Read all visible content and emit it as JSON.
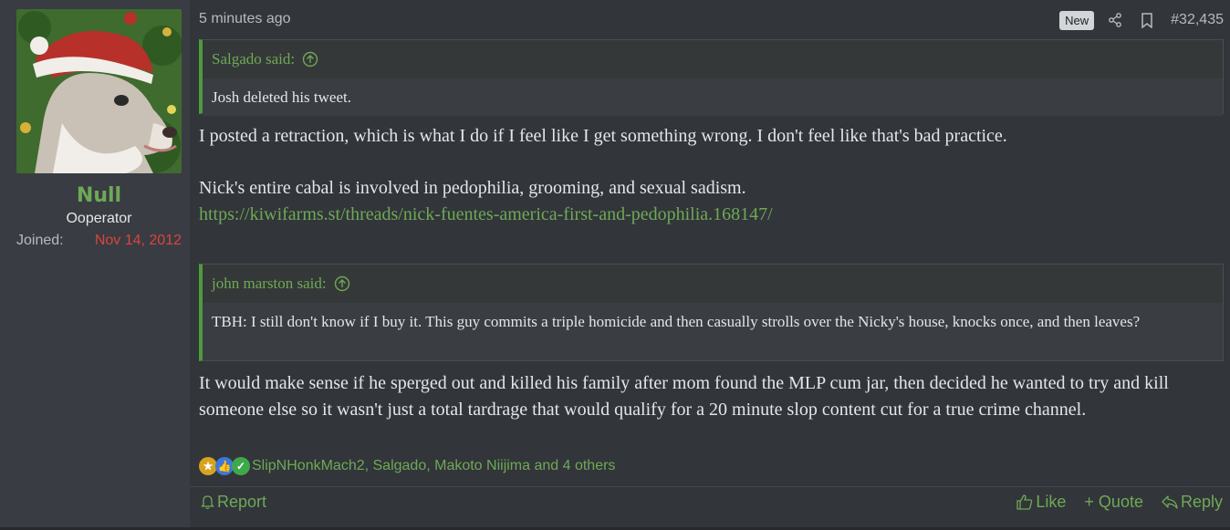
{
  "user": {
    "name": "Null",
    "title": "Ooperator",
    "joined_label": "Joined:",
    "joined_date": "Nov 14, 2012",
    "avatar": "avatar-dog-santa-hat"
  },
  "post": {
    "time": "5 minutes ago",
    "new_badge": "New",
    "number": "#32,435",
    "quote1": {
      "author": "Salgado said:",
      "text": "Josh deleted his tweet."
    },
    "para1": "I posted a retraction, which is what I do if I feel like I get something wrong. I don't feel like that's bad practice.",
    "para2": "Nick's entire cabal is involved in pedophilia, grooming, and sexual sadism.",
    "link": "https://kiwifarms.st/threads/nick-fuentes-america-first-and-pedophilia.168147/",
    "quote2": {
      "author": "john marston said:",
      "text": "TBH: I still don't know if I buy it. This guy commits a triple homicide and then casually strolls over the Nicky's house, knocks once, and then leaves?"
    },
    "para3": "It would make sense if he sperged out and killed his family after mom found the MLP cum jar, then decided he wanted to try and kill someone else so it wasn't just a total tardrage that would qualify for a 20 minute slop content cut for a true crime channel.",
    "reactions_text": "SlipNHonkMach2, Salgado, Makoto Niijima and 4 others"
  },
  "footer": {
    "report": "Report",
    "like": "Like",
    "quote": "+ Quote",
    "reply": "Reply"
  },
  "colors": {
    "accent_green": "#6ea956",
    "quote_border": "#4c9b3c",
    "joined_red": "#d9453f",
    "bg": "#32353a"
  }
}
